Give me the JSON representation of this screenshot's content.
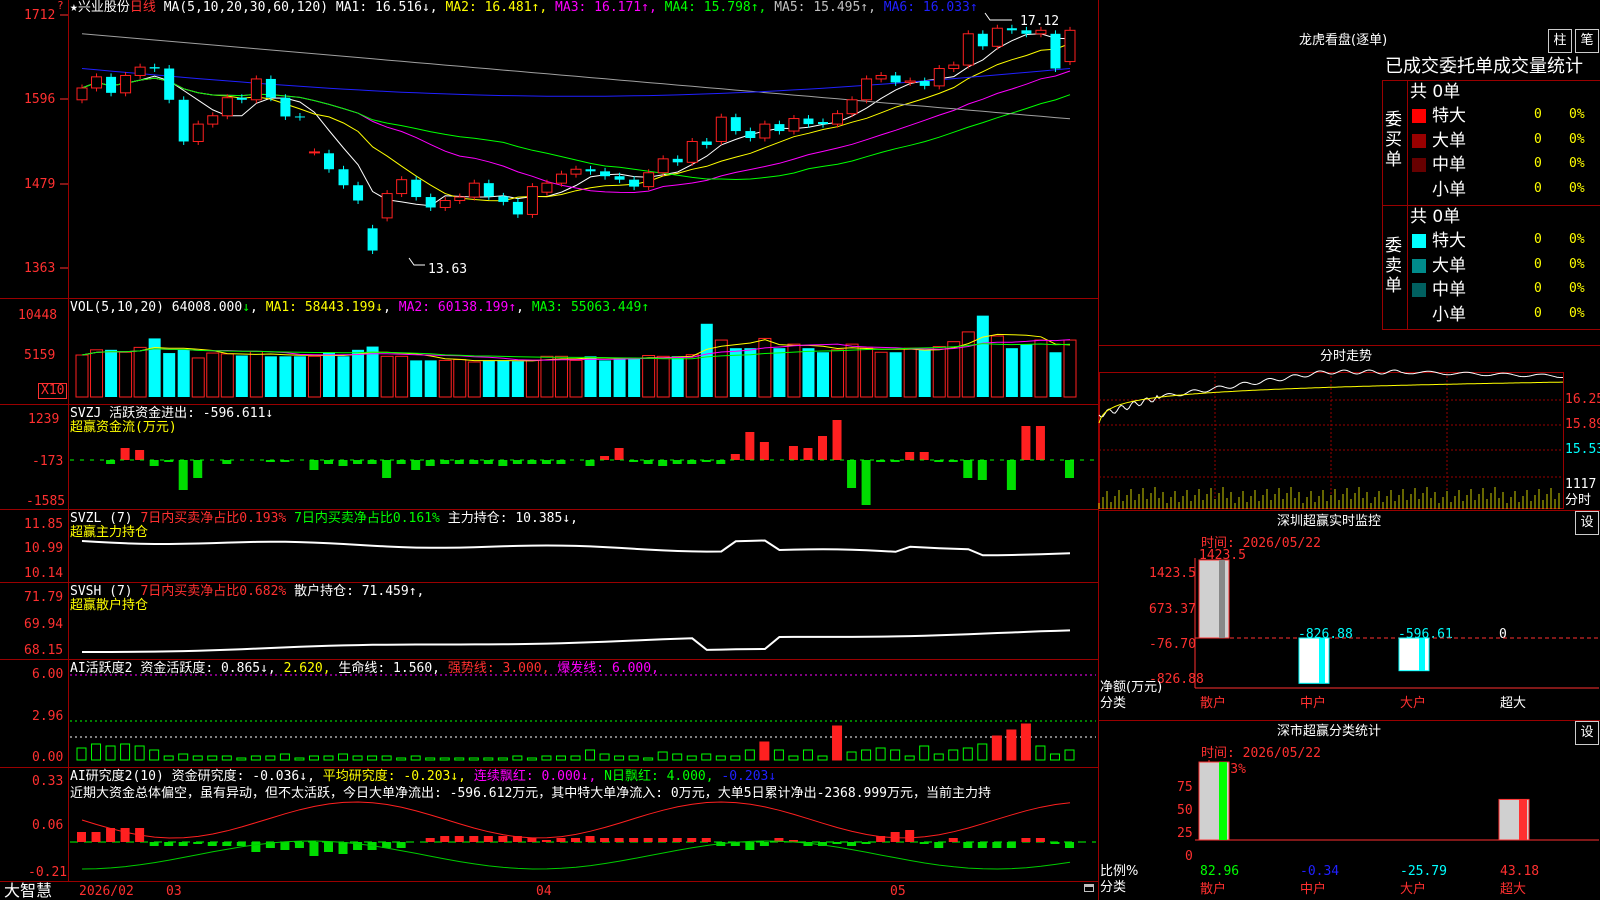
{
  "colors": {
    "up": "#ff2020",
    "down": "#00ffff",
    "bg": "#000000",
    "grid": "#9a0000",
    "white": "#ffffff",
    "yellow": "#ffff00",
    "magenta": "#ff00ff",
    "green": "#00ff00",
    "blue": "#2020ff",
    "gray": "#a0a0a0",
    "labelRed": "#ff3030"
  },
  "header": {
    "star": "★",
    "stock": "兴业股份",
    "period": "日线",
    "ma_params": "MA(5,10,20,30,60,120)",
    "ma": [
      {
        "label": "MA1:",
        "value": "16.516",
        "arrow": "↓",
        "color": "#ffffff"
      },
      {
        "label": "MA2:",
        "value": "16.481",
        "arrow": "↑",
        "color": "#ffff00"
      },
      {
        "label": "MA3:",
        "value": "16.171",
        "arrow": "↑",
        "color": "#ff00ff"
      },
      {
        "label": "MA4:",
        "value": "15.798",
        "arrow": "↑",
        "color": "#00ff00"
      },
      {
        "label": "MA5:",
        "value": "15.495",
        "arrow": "↑",
        "color": "#c0c0c0"
      },
      {
        "label": "MA6:",
        "value": "16.033",
        "arrow": "↑",
        "color": "#2020ff"
      }
    ],
    "high_label": "17.12",
    "low_label": "13.63"
  },
  "price_axis": [
    "1712",
    "1596",
    "1479",
    "1363"
  ],
  "vol": {
    "title": "VOL(5,10,20)",
    "value": "64008.000",
    "arrow": "↓",
    "ma1": "MA1: 58443.199↓",
    "ma2": "MA2: 60138.199↑",
    "ma3": "MA3: 55063.449↑",
    "axis": [
      "10448",
      "5159"
    ],
    "unit": "X10"
  },
  "svzj": {
    "title": "SVZJ  活跃资金进出: -596.611↓",
    "subtitle": "超赢资金流(万元)",
    "axis": [
      "1239",
      "-173",
      "-1585"
    ]
  },
  "svzl": {
    "title": "SVZL (7)",
    "t1": "7日内买卖净占比0.193%",
    "t2": "7日内买卖净占比0.161%",
    "t3": "主力持仓: 10.385↓,",
    "subtitle": "超赢主力持仓",
    "axis": [
      "11.85",
      "10.99",
      "10.14"
    ]
  },
  "svsh": {
    "title": "SVSH (7)",
    "t1": "7日内买卖净占比0.682%",
    "t2": "散户持仓: 71.459↑,",
    "subtitle": "超赢散户持仓",
    "axis": [
      "71.79",
      "69.94",
      "68.15"
    ]
  },
  "ai_active": {
    "title": "AI活跃度2",
    "t1": "资金活跃度: 0.865↓,",
    "t2": "2.620,",
    "t3": "生命线: 1.560,",
    "t4": "强势线: 3.000,",
    "t5": "爆发线: 6.000,",
    "axis": [
      "6.00",
      "2.96",
      "0.00"
    ]
  },
  "ai_research": {
    "title": "AI研究度2(10)",
    "t1": "资金研究度: -0.036↓,",
    "t2": "平均研究度: -0.203↓,",
    "t3": "连续飘红: 0.000↓,",
    "t4": "N日飘红: 4.000,",
    "t5": "-0.203↓",
    "comment": "近期大资金总体偏空，虽有异动，但不太活跃，今日大单净流出: -596.612万元，其中特大单净流入: 0万元，大单5日累计净出-2368.999万元，当前主力持",
    "axis": [
      "0.33",
      "0.06",
      "-0.21"
    ]
  },
  "bottom": {
    "brand": "大智慧",
    "dates": [
      "2026/02",
      "03",
      "04",
      "05"
    ]
  },
  "dragon": {
    "title": "龙虎看盘(逐单)",
    "btn1": "柱",
    "btn2": "笔",
    "subtitle": "已成交委托单成交量统计",
    "buy_label": "委买单",
    "sell_label": "委卖单",
    "buy_total": "共 0单",
    "sell_total": "共 0单",
    "buy_rows": [
      {
        "name": "特大",
        "count": "0",
        "pct": "0%",
        "color": "#ff0000"
      },
      {
        "name": "大单",
        "count": "0",
        "pct": "0%",
        "color": "#990000"
      },
      {
        "name": "中单",
        "count": "0",
        "pct": "0%",
        "color": "#660000"
      },
      {
        "name": "小单",
        "count": "0",
        "pct": "0%",
        "color": "#000000"
      }
    ],
    "sell_rows": [
      {
        "name": "特大",
        "count": "0",
        "pct": "0%",
        "color": "#00ffff"
      },
      {
        "name": "大单",
        "count": "0",
        "pct": "0%",
        "color": "#008b8b"
      },
      {
        "name": "中单",
        "count": "0",
        "pct": "0%",
        "color": "#006060"
      },
      {
        "name": "小单",
        "count": "0",
        "pct": "0%",
        "color": "#000000"
      }
    ]
  },
  "intraday": {
    "title": "分时走势",
    "axis": [
      "16.25",
      "15.89",
      "15.53"
    ],
    "vol_axis": [
      "1117",
      "分时"
    ]
  },
  "monitor": {
    "title": "深圳超赢实时监控",
    "btn": "设",
    "time": "时间: 2026/05/22",
    "top_val": "1423.5",
    "axis": [
      "1423.5",
      "673.37",
      "-76.70",
      "-826.88"
    ],
    "bar_labels": [
      "-826.88",
      "-596.61",
      "0"
    ],
    "ylabel1": "净额(万元)",
    "ylabel2": "分类",
    "cats": [
      "散户",
      "中户",
      "大户",
      "超大"
    ]
  },
  "classify": {
    "title": "深市超赢分类统计",
    "btn": "设",
    "time": "时间: 2026/05/22",
    "top_val": "+0.33%",
    "axis": [
      "75",
      "50",
      "25",
      "0"
    ],
    "vals": [
      "82.96",
      "-0.34",
      "-25.79",
      "43.18"
    ],
    "ylabel1": "比例%",
    "ylabel2": "分类",
    "cats": [
      "散户",
      "中户",
      "大户",
      "超大"
    ]
  },
  "chart_data": [
    {
      "type": "candlestick",
      "title": "兴业股份 日线",
      "ylim": [
        13.5,
        17.3
      ],
      "open": [
        15.95,
        16.12,
        16.28,
        16.05,
        16.3,
        16.42,
        16.4,
        15.95,
        15.35,
        15.6,
        15.72,
        15.98,
        15.95,
        16.25,
        15.98,
        15.71,
        15.2,
        15.18,
        14.95,
        14.72,
        14.1,
        14.25,
        14.6,
        14.8,
        14.55,
        14.4,
        14.5,
        14.55,
        14.75,
        14.56,
        14.48,
        14.3,
        14.62,
        14.75,
        14.88,
        14.95,
        14.92,
        14.85,
        14.8,
        14.7,
        14.9,
        15.1,
        15.05,
        15.35,
        15.35,
        15.7,
        15.5,
        15.4,
        15.6,
        15.5,
        15.68,
        15.63,
        15.6,
        15.75,
        15.95,
        16.25,
        16.3,
        16.2,
        16.22,
        16.15,
        16.4,
        16.45,
        16.9,
        16.72,
        16.98,
        16.95,
        16.9,
        16.9,
        16.5
      ],
      "close": [
        16.12,
        16.28,
        16.05,
        16.3,
        16.42,
        16.4,
        15.95,
        15.35,
        15.6,
        15.72,
        15.98,
        15.95,
        16.25,
        15.98,
        15.71,
        15.7,
        15.2,
        14.95,
        14.72,
        14.5,
        13.78,
        14.6,
        14.8,
        14.55,
        14.4,
        14.5,
        14.55,
        14.75,
        14.56,
        14.48,
        14.3,
        14.7,
        14.75,
        14.88,
        14.95,
        14.92,
        14.85,
        14.8,
        14.7,
        14.9,
        15.1,
        15.05,
        15.35,
        15.3,
        15.7,
        15.5,
        15.4,
        15.6,
        15.5,
        15.68,
        15.6,
        15.6,
        15.75,
        15.95,
        16.25,
        16.3,
        16.2,
        16.22,
        16.15,
        16.4,
        16.45,
        16.9,
        16.72,
        16.98,
        16.95,
        16.9,
        16.95,
        16.4,
        16.95
      ]
    },
    {
      "type": "bar",
      "title": "VOL",
      "values": [
        5159,
        5800,
        5800,
        5500,
        6100,
        7200,
        5400,
        5800,
        4800,
        5400,
        5300,
        5100,
        5600,
        5000,
        5000,
        5000,
        5000,
        5500,
        5000,
        5800,
        6200,
        5000,
        5000,
        4500,
        4500,
        4500,
        4600,
        4300,
        4500,
        4500,
        4400,
        4500,
        5000,
        5000,
        4500,
        5000,
        4500,
        4700,
        4800,
        5100,
        5000,
        5000,
        5200,
        9000,
        7000,
        6000,
        6000,
        7200,
        6000,
        6500,
        6000,
        5500,
        5800,
        6500,
        6000,
        5500,
        5500,
        6000,
        5800,
        6200,
        6800,
        8000,
        10000,
        7500,
        6000,
        6500,
        7000,
        5500,
        7000
      ]
    },
    {
      "type": "bar",
      "title": "超赢资金流(万元)",
      "ylim": [
        -1585,
        1239
      ]
    },
    {
      "type": "line",
      "title": "超赢主力持仓",
      "ylim": [
        10.14,
        11.85
      ]
    },
    {
      "type": "line",
      "title": "超赢散户持仓",
      "ylim": [
        68.15,
        71.79
      ]
    },
    {
      "type": "bar",
      "title": "AI活跃度2",
      "ylim": [
        0,
        6
      ]
    },
    {
      "type": "bar",
      "title": "AI研究度2(10)",
      "ylim": [
        -0.21,
        0.33
      ]
    },
    {
      "type": "bar",
      "title": "深圳超赢实时监控",
      "categories": [
        "散户",
        "中户",
        "大户",
        "超大"
      ],
      "values": [
        1423.5,
        -826.88,
        -596.61,
        0
      ]
    },
    {
      "type": "bar",
      "title": "深市超赢分类统计",
      "categories": [
        "散户",
        "中户",
        "大户",
        "超大"
      ],
      "values": [
        82.96,
        -0.34,
        -25.79,
        43.18
      ]
    }
  ]
}
